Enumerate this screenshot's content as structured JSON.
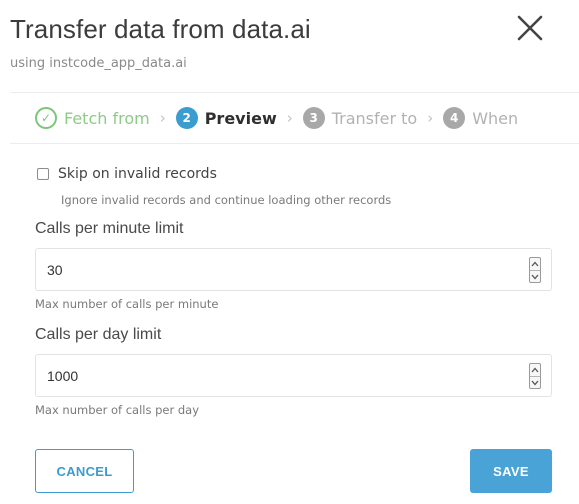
{
  "dialog": {
    "title": "Transfer data from data.ai",
    "subtitle": "using instcode_app_data.ai"
  },
  "steps": [
    {
      "number": "✓",
      "label": "Fetch from",
      "state": "done"
    },
    {
      "number": "2",
      "label": "Preview",
      "state": "active"
    },
    {
      "number": "3",
      "label": "Transfer to",
      "state": "todo"
    },
    {
      "number": "4",
      "label": "When",
      "state": "todo"
    }
  ],
  "step_separator": "›",
  "skip_invalid": {
    "label": "Skip on invalid records",
    "help": "Ignore invalid records and continue loading other records",
    "checked": false
  },
  "calls_per_minute": {
    "label": "Calls per minute limit",
    "value": "30",
    "help": "Max number of calls per minute"
  },
  "calls_per_day": {
    "label": "Calls per day limit",
    "value": "1000",
    "help": "Max number of calls per day"
  },
  "actions": {
    "cancel_label": "CANCEL",
    "save_label": "SAVE"
  },
  "colors": {
    "accent": "#3a9ccf",
    "done": "#7cc67a",
    "todo": "#a8a8a8"
  },
  "icons": {
    "close": "close-icon",
    "check": "check-icon",
    "spinner_up": "chevron-up-icon",
    "spinner_down": "chevron-down-icon"
  }
}
